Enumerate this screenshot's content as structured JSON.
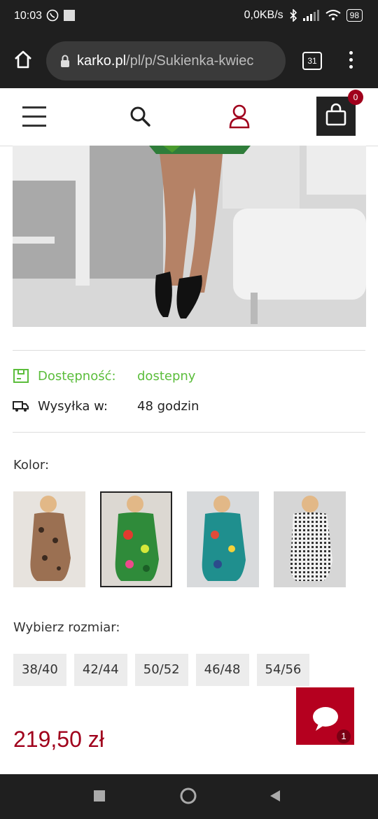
{
  "status": {
    "time": "10:03",
    "net_speed": "0,0KB/s",
    "battery": "98"
  },
  "browser": {
    "url_domain": "karko.pl",
    "url_path": "/pl/p/Sukienka-kwiec",
    "tab_count": "31"
  },
  "header": {
    "cart_count": "0"
  },
  "product": {
    "availability_label": "Dostępność:",
    "availability_value": "dostepny",
    "shipping_label": "Wysyłka w:",
    "shipping_value": "48 godzin",
    "color_label": "Kolor:",
    "colors": [
      "leopard",
      "green-floral",
      "teal-floral",
      "gingham"
    ],
    "size_label": "Wybierz rozmiar:",
    "sizes": [
      "38/40",
      "42/44",
      "50/52",
      "46/48",
      "54/56"
    ],
    "price": "219,50 zł"
  },
  "chat": {
    "unread": "1"
  },
  "colors": {
    "accent": "#a0001c",
    "available": "#5bbd3b",
    "chat": "#b5001f"
  }
}
